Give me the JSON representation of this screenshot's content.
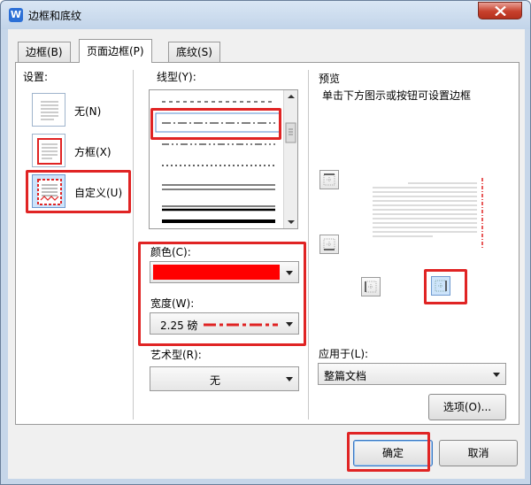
{
  "window": {
    "title": "边框和底纹"
  },
  "tabs": [
    {
      "label": "边框(B)"
    },
    {
      "label": "页面边框(P)"
    },
    {
      "label": "底纹(S)"
    }
  ],
  "settings": {
    "heading": "设置:",
    "options": [
      {
        "label": "无(N)"
      },
      {
        "label": "方框(X)"
      },
      {
        "label": "自定义(U)"
      }
    ]
  },
  "line_style": {
    "label": "线型(Y):"
  },
  "color": {
    "label": "颜色(C):",
    "value_hex": "#ff0000"
  },
  "width": {
    "label": "宽度(W):",
    "value": "2.25 磅"
  },
  "art": {
    "label": "艺术型(R):",
    "value": "无"
  },
  "preview": {
    "heading": "预览",
    "hint": "单击下方图示或按钮可设置边框"
  },
  "apply": {
    "label": "应用于(L):",
    "value": "整篇文档"
  },
  "buttons": {
    "options": "选项(O)...",
    "ok": "确定",
    "cancel": "取消"
  },
  "colors": {
    "highlight": "#e02424",
    "accent_red": "#ff0000",
    "selection_blue": "#cde4fb"
  }
}
